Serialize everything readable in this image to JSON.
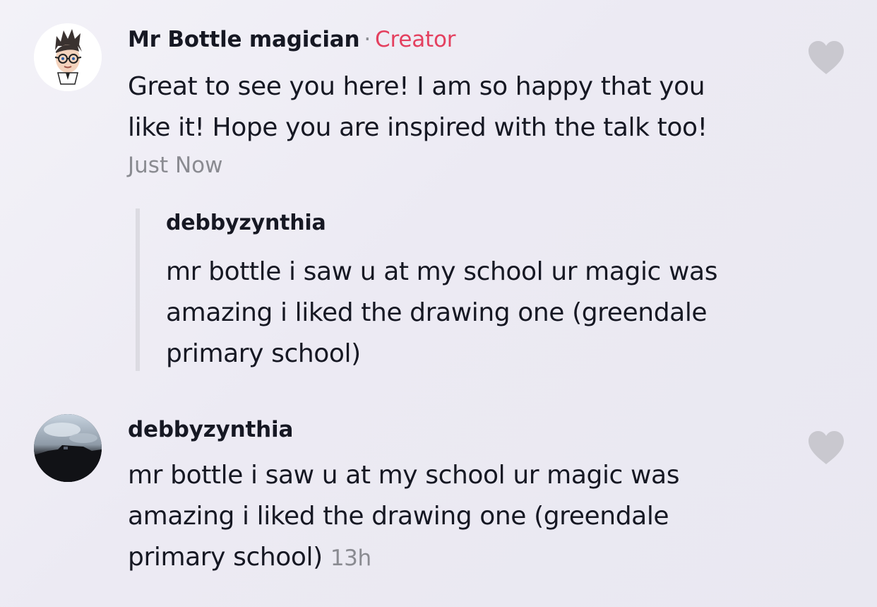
{
  "comments": [
    {
      "username": "Mr Bottle magician",
      "separator": "·",
      "badge": "Creator",
      "text_lines": [
        "Great to see you here! I am so happy that you",
        "like it! Hope you are inspired with the talk too!"
      ],
      "time": "Just Now",
      "avatar_icon": "cartoon-magician-avatar",
      "like_icon": "heart-icon",
      "quoted_reply": {
        "username": "debbyzynthia",
        "text_lines": [
          "mr bottle i saw u at my school ur magic was",
          "amazing i liked the drawing one (greendale",
          "primary school)"
        ]
      }
    },
    {
      "username": "debbyzynthia",
      "text_lines": [
        "mr bottle i saw u at my school ur magic was",
        "amazing i liked the drawing one (greendale",
        "primary school)"
      ],
      "time": "13h",
      "avatar_icon": "sky-photo-avatar",
      "like_icon": "heart-icon"
    }
  ],
  "colors": {
    "creator_badge": "#e4405f",
    "secondary_text": "#8a8b91",
    "heart": "#c9c8cf"
  }
}
